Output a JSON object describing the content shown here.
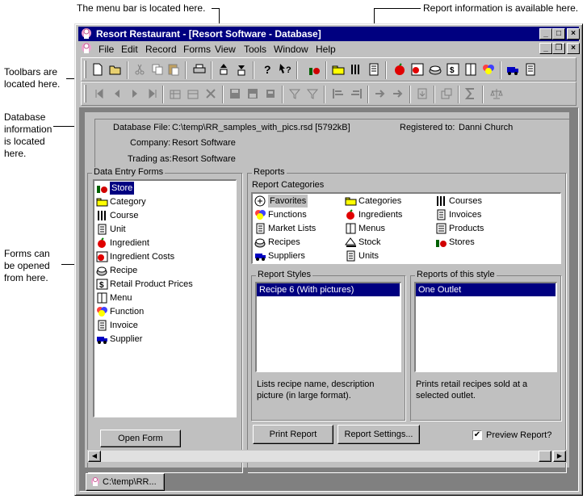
{
  "annotations": {
    "menu_bar": "The menu bar is located here.",
    "report_info": "Report information is available here.",
    "toolbars": [
      "Toolbars are",
      "located here."
    ],
    "database_info": [
      "Database",
      "information",
      "is located",
      "here."
    ],
    "forms": [
      "Forms can",
      "be opened",
      "from here."
    ]
  },
  "window": {
    "title": "Resort Restaurant - [Resort Software - Database]",
    "min_label": "_",
    "max_label": "□",
    "close_label": "×",
    "restore_label": "❐"
  },
  "menu": [
    "File",
    "Edit",
    "Record",
    "Forms",
    "View",
    "Tools",
    "Window",
    "Help"
  ],
  "database": {
    "file_label": "Database File:",
    "file_value": "C:\\temp\\RR_samples_with_pics.rsd [5792kB]",
    "registered_label": "Registered to:",
    "registered_value": "Danni Church",
    "company_label": "Company:",
    "company_value": "Resort Software",
    "trading_label": "Trading as:",
    "trading_value": "Resort Software"
  },
  "data_entry": {
    "title": "Data Entry Forms",
    "items": [
      "Store",
      "Category",
      "Course",
      "Unit",
      "Ingredient",
      "Ingredient Costs",
      "Recipe",
      "Retail Product Prices",
      "Menu",
      "Function",
      "Invoice",
      "Supplier"
    ],
    "selected": "Store",
    "open_button": "Open Form"
  },
  "reports": {
    "title": "Reports",
    "categories_label": "Report Categories",
    "categories": [
      [
        "Favorites",
        "Categories",
        "Courses"
      ],
      [
        "Functions",
        "Ingredients",
        "Invoices"
      ],
      [
        "Market Lists",
        "Menus",
        "Products"
      ],
      [
        "Recipes",
        "Stock",
        "Stores"
      ],
      [
        "Suppliers",
        "Units",
        ""
      ]
    ],
    "styles_title": "Report Styles",
    "styles_selected": "Recipe  6 (With pictures)",
    "styles_desc": [
      "Lists recipe name, description",
      "picture (in large format)."
    ],
    "of_style_title": "Reports of this style",
    "of_style_selected": "One Outlet",
    "of_style_desc": [
      "Prints retail recipes sold at a",
      "selected outlet."
    ],
    "print_button": "Print Report",
    "settings_button": "Report Settings...",
    "preview_label": "Preview Report?",
    "preview_checked": "✔"
  },
  "tab": {
    "label": "C:\\temp\\RR..."
  }
}
